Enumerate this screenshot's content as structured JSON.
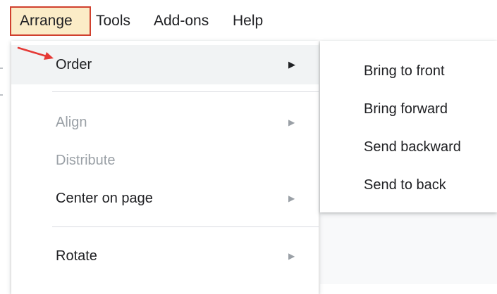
{
  "menubar": {
    "items": [
      {
        "label": "Arrange"
      },
      {
        "label": "Tools"
      },
      {
        "label": "Add-ons"
      },
      {
        "label": "Help"
      }
    ]
  },
  "dropdown": {
    "items": [
      {
        "label": "Order",
        "has_submenu": true,
        "disabled": false,
        "highlighted": true
      },
      {
        "label": "Align",
        "has_submenu": true,
        "disabled": true
      },
      {
        "label": "Distribute",
        "has_submenu": false,
        "disabled": true
      },
      {
        "label": "Center on page",
        "has_submenu": true,
        "disabled": false
      },
      {
        "label": "Rotate",
        "has_submenu": true,
        "disabled": false
      }
    ],
    "submenu_arrow_glyph": "▶"
  },
  "submenu": {
    "items": [
      {
        "label": "Bring to front"
      },
      {
        "label": "Bring forward"
      },
      {
        "label": "Send backward"
      },
      {
        "label": "Send to back"
      }
    ]
  },
  "colors": {
    "highlight_box_border": "#d0402e",
    "highlight_box_fill": "#fbecc7",
    "annotation_arrow": "#e53935",
    "hover_background": "#f1f3f4",
    "disabled_text": "#9aa0a6"
  }
}
